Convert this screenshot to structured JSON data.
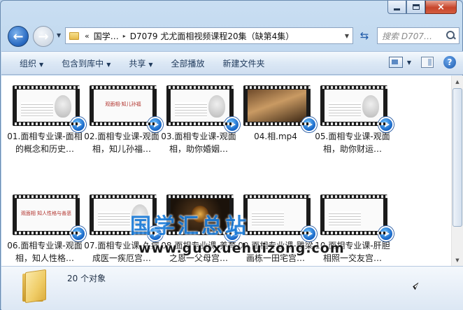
{
  "window": {
    "caption": {
      "minimize": "minimize",
      "maximize": "maximize",
      "close": "×"
    }
  },
  "address": {
    "chevrons": "«",
    "segments": [
      "国学…",
      "D7079 尤尤面相视频课程20集（缺第4集）"
    ],
    "separator": "▸"
  },
  "search": {
    "placeholder": "搜索 D707…"
  },
  "toolbar": {
    "items": [
      {
        "label": "组织",
        "dropdown": true
      },
      {
        "label": "包含到库中",
        "dropdown": true
      },
      {
        "label": "共享",
        "dropdown": true
      },
      {
        "label": "全部播放",
        "dropdown": false
      },
      {
        "label": "新建文件夹",
        "dropdown": false
      }
    ],
    "help": "?"
  },
  "files": [
    {
      "label": "01.面相专业课-面相的概念和历史…",
      "style": "doc-face",
      "thumb_text": ""
    },
    {
      "label": "02.面相专业课-观面相，知儿孙福…",
      "style": "title",
      "thumb_text": "观面相·知儿孙福"
    },
    {
      "label": "03.面相专业课-观面相，助你婚姻…",
      "style": "doc-face",
      "thumb_text": ""
    },
    {
      "label": "04.相.mp4",
      "style": "scene",
      "thumb_text": ""
    },
    {
      "label": "05.面相专业课-观面相，助你财运…",
      "style": "doc-face",
      "thumb_text": ""
    },
    {
      "label": "06.面相专业课-观面相，知人性格…",
      "style": "title",
      "thumb_text": "观面相 知人性格与善恶"
    },
    {
      "label": "07.面相专业课-久病成医一疾厄宫…",
      "style": "doc-face",
      "thumb_text": ""
    },
    {
      "label": "08.面相专业课-养育之恩一父母宫…",
      "style": "dark",
      "thumb_text": ""
    },
    {
      "label": "09.面相专业课-雕梁画栋一田宅宫…",
      "style": "doc",
      "thumb_text": ""
    },
    {
      "label": "10.面相专业课-肝胆相照一交友宫…",
      "style": "doc",
      "thumb_text": ""
    }
  ],
  "watermark": {
    "cn": "国学汇总站",
    "url": "www.guoxuehuizong.com"
  },
  "details": {
    "count": "20 个对象"
  },
  "colors": {
    "accent": "#1c7cd8",
    "badge": "#1462c4",
    "close": "#c7452b"
  }
}
